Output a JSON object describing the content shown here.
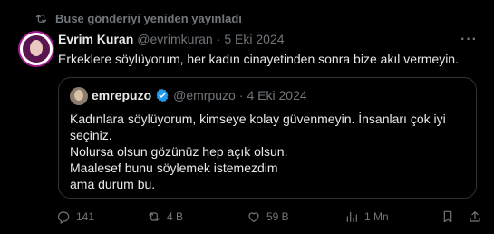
{
  "repost": {
    "text": "Buse gönderiyi yeniden yayınladı"
  },
  "tweet": {
    "author_name": "Evrim Kuran",
    "handle": "@evrimkuran",
    "dot": "·",
    "date": "5 Eki 2024",
    "text": "Erkeklere söylüyorum, her kadın cinayetinden sonra bize akıl vermeyin.",
    "more": "···"
  },
  "quote": {
    "author_name": "emrepuzo",
    "handle": "@emrpuzo",
    "dot": "·",
    "date": "4 Eki 2024",
    "lines": [
      "Kadınlara söylüyorum, kimseye kolay güvenmeyin. İnsanları çok iyi",
      "seçiniz.",
      "Nolursa olsun gözünüz hep açık olsun.",
      "Maalesef bunu söylemek istemezdim",
      "ama durum bu."
    ]
  },
  "actions": {
    "replies": "141",
    "reposts": "4 B",
    "likes": "59 B",
    "views": "1 Mn"
  },
  "colors": {
    "accent": "#1d9bf0",
    "muted": "#71767b",
    "border": "#2f3336"
  }
}
